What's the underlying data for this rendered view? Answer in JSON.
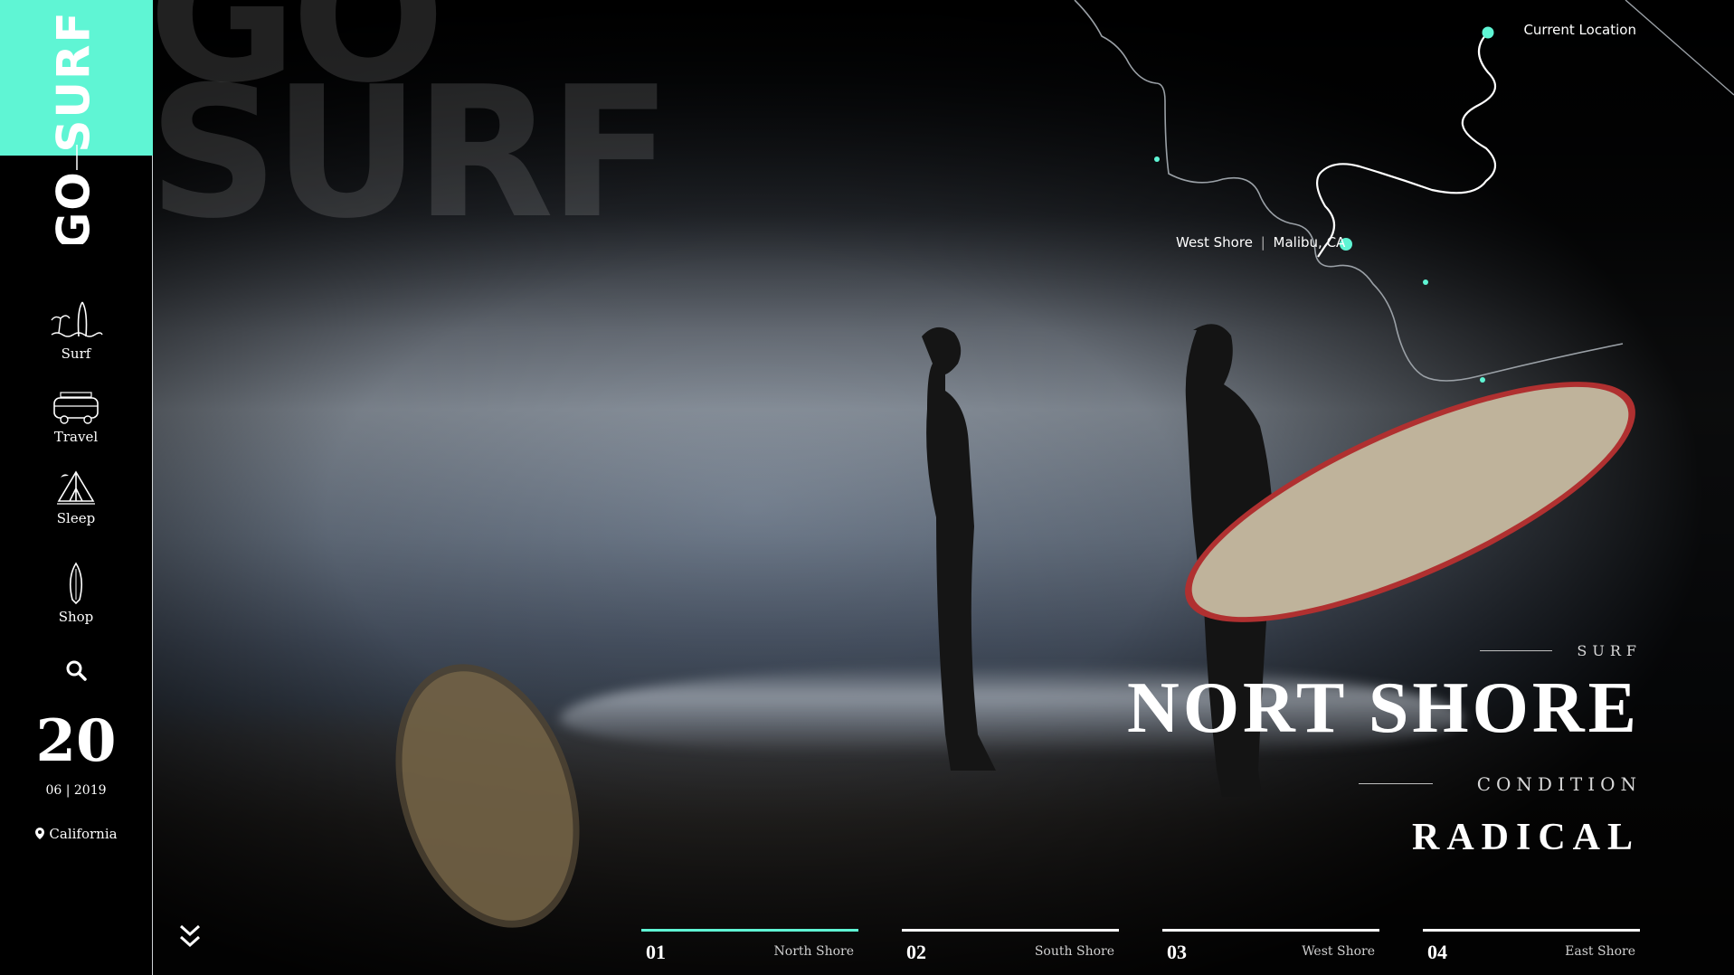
{
  "brand": {
    "go": "GO",
    "surf": "SURF",
    "accent_color": "#5ff5d4"
  },
  "background_text": "GO\nSURF",
  "nav": [
    {
      "label": "Surf",
      "icon": "surf-beach-icon"
    },
    {
      "label": "Travel",
      "icon": "van-icon"
    },
    {
      "label": "Sleep",
      "icon": "tent-icon"
    },
    {
      "label": "Shop",
      "icon": "surfboard-icon"
    }
  ],
  "search": {
    "icon": "search-icon"
  },
  "date": {
    "day": "20",
    "month_year": "06 | 2019"
  },
  "location": {
    "icon": "map-pin-icon",
    "name": "California"
  },
  "map": {
    "current_location": "Current Location",
    "spot_name": "West Shore",
    "spot_place": "Malibu, CA"
  },
  "headline": {
    "kicker": "SURF",
    "title": "NORT SHORE",
    "condition_label": "CONDITION",
    "condition_value": "RADICAL"
  },
  "tabs": [
    {
      "num": "01",
      "label": "North Shore",
      "active": true
    },
    {
      "num": "02",
      "label": "South Shore",
      "active": false
    },
    {
      "num": "03",
      "label": "West Shore",
      "active": false
    },
    {
      "num": "04",
      "label": "East Shore",
      "active": false
    }
  ],
  "scroll": {
    "icon": "double-chevron-down-icon"
  }
}
